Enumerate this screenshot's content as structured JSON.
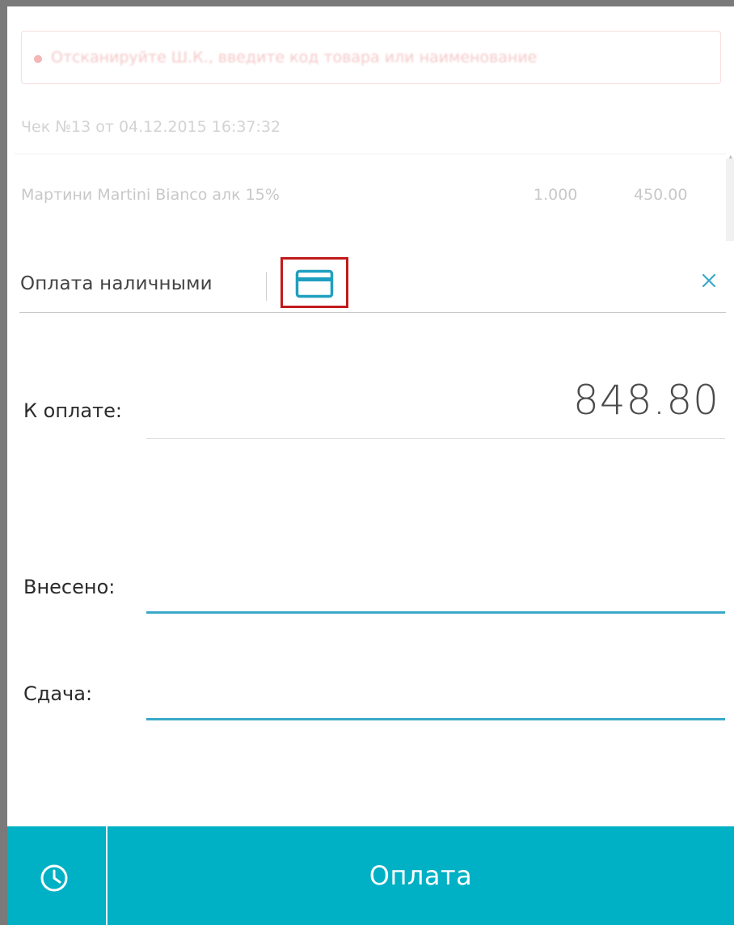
{
  "background": {
    "search_placeholder": "Отсканируйте Ш.К., введите код товара или наименование",
    "receipt_title": "Чек №13 от 04.12.2015 16:37:32",
    "items": [
      {
        "name": "Мартини Martini Bianco алк 15%",
        "qty": "1.000",
        "price": "450.00"
      }
    ]
  },
  "payment": {
    "cash_tab_label": "Оплата наличными",
    "card_tab_icon": "credit-card-icon",
    "close_icon": "close-icon",
    "to_pay_label": "К оплате:",
    "to_pay_amount": "848.80",
    "deposited_label": "Внесено:",
    "deposited_value": "",
    "change_label": "Сдача:",
    "change_value": ""
  },
  "bottom_bar": {
    "history_icon": "clock-icon",
    "pay_button_label": "Оплата"
  },
  "colors": {
    "accent": "#00b0c5",
    "input_underline": "#3aa9c8",
    "highlight_border": "#c21a1a",
    "icon_teal": "#1f9fbf"
  }
}
